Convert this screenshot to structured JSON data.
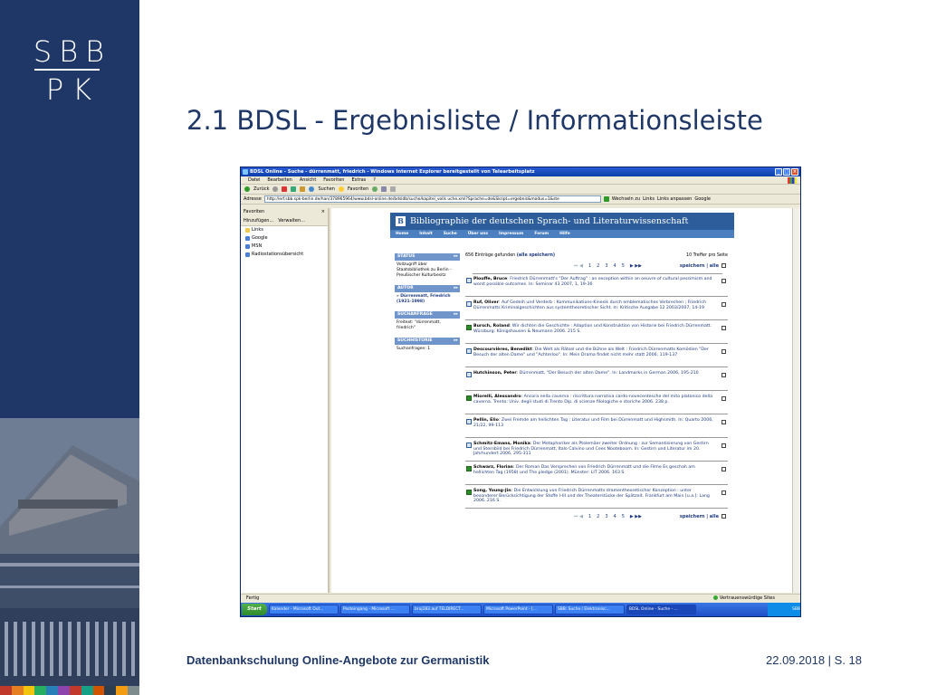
{
  "logo": {
    "line1": "SBB",
    "line2": "PK"
  },
  "slide": {
    "title": "2.1 BDSL - Ergebnisliste / Informationsleiste",
    "footer_left": "Datenbankschulung Online-Angebote zur Germanistik",
    "footer_right": "22.09.2018 | S. 18"
  },
  "colors": {
    "navy": "#1f3767",
    "bdsl_blue": "#2d5d9a"
  },
  "browser": {
    "title": "BDSL Online - Suche - dürrenmatt, friedrich - Windows Internet Explorer bereitgestellt von Telearbeitsplatz",
    "menu": [
      "Datei",
      "Bearbeiten",
      "Ansicht",
      "Favoriten",
      "Extras",
      "?"
    ],
    "toolbar": {
      "back": "Zurück",
      "search": "Suchen",
      "favorites": "Favoriten"
    },
    "address": {
      "label": "Adresse",
      "url": "http://erf.sbb.spk-berlin.de/han/378965964/www.bdsl-online.de/bdsldb/suche/kapitel_volls uche.xml?Sprache=de&Skript=ergebnis&modus=1&ste",
      "go": "Wechseln zu",
      "links": "Links",
      "links_anpassen": "Links anpassen",
      "google": "Google"
    },
    "favorites": {
      "header": "Favoriten",
      "add": "Hinzufügen...",
      "manage": "Verwalten...",
      "items": [
        "Links",
        "Google",
        "MSN",
        "Radiostationsübersicht"
      ]
    },
    "status": "Fertig",
    "trusted": "Vertrauenswürdige Sites"
  },
  "taskbar": {
    "start": "Start",
    "tasks": [
      "Kalender - Microsoft Out...",
      "Posteingang - Microsoft ...",
      "bruj183 auf TELDIRECT...",
      "Microsoft PowerPoint - [...",
      "SBB: Suche / Elektronisc...",
      "BDSL Online - Suche - ..."
    ],
    "tray": "SBB"
  },
  "bdsl": {
    "header": "Bibliographie der deutschen Sprach- und Literaturwissenschaft",
    "nav": [
      "Home",
      "Inhalt",
      "Suche",
      "Über uns",
      "Impressum",
      "Forum",
      "Hilfe"
    ],
    "sidebar": [
      {
        "title": "STATUS",
        "body": "Vollzugriff über Staatsbibliothek zu Berlin - Preußischer Kulturbesitz"
      },
      {
        "title": "AUTOR",
        "body": "Dürrenmatt, Friedrich (1921-1998)"
      },
      {
        "title": "SUCHANFRAGE",
        "body": "Freitext: \"dürrenmatt, friedrich\""
      },
      {
        "title": "SUCHHISTORIE",
        "body": "Suchanfragen: 1"
      }
    ],
    "found": "656 Einträge gefunden",
    "save_all_link": "(alle speichern)",
    "per_page": "10 Treffer pro Seite",
    "pages": [
      "1",
      "2",
      "3",
      "4",
      "5"
    ],
    "save_label": "speichern | alle",
    "results": [
      {
        "author": "Plouffe, Bruce",
        "text": ": Friedrich Dürrenmatt's \"Der Auftrag\" : an exception within an oeuvre of cultural pessimism and worst possible outcomes. In: Seminar 43 2007, 1, 19-36"
      },
      {
        "author": "Ruf, Oliver",
        "text": ": Auf Gedeih und Verderb : Kommunikations-Kinesik durch emblematisches Verbrechen ; Friedrich Dürrenmatts Kriminalgeschichten aus systemtheoretischer Sicht. In: Kritische Ausgabe 12 2003/2007, 14-19"
      },
      {
        "author": "Bursch, Roland",
        "text": ": Wir dichten die Geschichte : Adaption und Konstruktion von Historie bei Friedrich Dürrenmatt. Würzburg: Königshausen & Neumann 2006. 215 S."
      },
      {
        "author": "Descourvières, Benedikt",
        "text": ": Die Welt als Rätsel und die Bühne als Welt : Friedrich Dürrenmatts Komödien \"Der Besuch der alten Dame\" und \"Achterloo\". In: Mein Drama findet nicht mehr statt 2006, 119-137"
      },
      {
        "author": "Hutchinson, Peter",
        "text": ": Dürrenmatt, \"Der Besuch der alten Dame\". In: Landmarks in German 2006, 195-210"
      },
      {
        "author": "Miorelli, Alessandro",
        "text": ": Ancora nella caverna : riscrittura narrativa cardo-novecentesche del mito platonico della caverna. Trento: Univ. degli studi di Trento Dip. di scienze filologiche e storiche 2006. 238 p."
      },
      {
        "author": "Pellin, Elio",
        "text": ": Zwei Fremde am hellichten Tag : Literatur und Film bei Dürrenmatt und Highsmith. In: Quarto 2006, 21/22, 99-113"
      },
      {
        "author": "Schmitz-Emans, Monika",
        "text": ": Der Metaphoriker als Ptolemäer zweiter Ordnung : zur Semantisierung von Gestirn und Sternbild bei Friedrich Dürrenmatt, Italo Calvino und Cees Nooteboom. In: Gestirn und Literatur im 20. Jahrhundert 2006, 295-311"
      },
      {
        "author": "Schwarz, Florian",
        "text": ": Der Roman Das Versprechen von Friedrich Dürrenmatt und die Filme Es geschah am hellichten Tag (1958) und The pledge (2001). Münster: LIT 2006. 163 S."
      },
      {
        "author": "Song, Young-Jin",
        "text": ": Die Entwicklung von Friedrich Dürrenmatts dramentheoretischer Konzeption : unter besonderer Berücksichtigung der Stoffe I-III und der Theaterstücke der Spätzeit. Frankfurt am Main [u.a.]: Lang 2006. 216 S."
      }
    ],
    "result_icons": [
      "doc",
      "doc",
      "book",
      "doc",
      "doc",
      "book",
      "doc",
      "doc",
      "book",
      "book"
    ]
  }
}
